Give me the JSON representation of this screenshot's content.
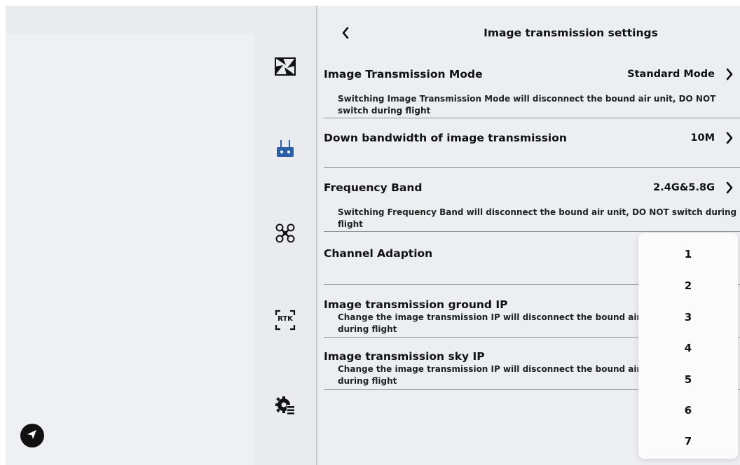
{
  "header": {
    "title": "Image transmission settings"
  },
  "rail": {
    "icons": [
      "camera-icon",
      "remote-controller-icon",
      "drone-icon",
      "rtk-icon",
      "gear-list-icon"
    ],
    "rtk_label": "RTK"
  },
  "settings": {
    "mode": {
      "title": "Image Transmission Mode",
      "value": "Standard Mode",
      "hint_line1": "Switching Image Transmission Mode will disconnect the bound air unit, DO NOT",
      "hint_line2": "switch during flight"
    },
    "bandwidth": {
      "title": "Down bandwidth of image transmission",
      "value": "10M"
    },
    "band": {
      "title": "Frequency Band",
      "value": "2.4G&5.8G",
      "hint_line1": "Switching Frequency Band will disconnect the bound air unit, DO NOT switch during",
      "hint_line2": "flight"
    },
    "channel": {
      "title": "Channel Adaption"
    },
    "ground_ip": {
      "title": "Image transmission ground IP",
      "hint_line1": "Change the image transmission IP will disconnect the bound air ur",
      "hint_line2": "during flight"
    },
    "sky_ip": {
      "title": "Image transmission sky IP",
      "hint_line1": "Change the image transmission IP will disconnect the bound air ur",
      "hint_line2": "during flight"
    }
  },
  "dropdown": {
    "options": [
      "1",
      "2",
      "3",
      "4",
      "5",
      "6",
      "7"
    ]
  },
  "colors": {
    "panel_bg": "#eceef1",
    "rail_bg": "#e9ebee",
    "accent_blue": "#2a5fa8",
    "separator": "#8e9196"
  }
}
